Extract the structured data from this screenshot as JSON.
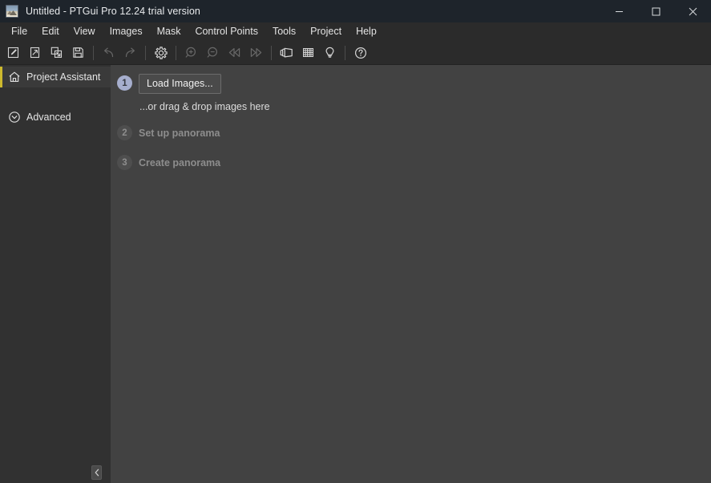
{
  "window": {
    "title": "Untitled - PTGui Pro 12.24 trial version",
    "app_icon": "panorama-image-icon",
    "controls": {
      "minimize": "minimize-icon",
      "maximize": "maximize-icon",
      "close": "close-icon"
    },
    "titlebar_color": "#1e242b"
  },
  "menubar": {
    "items": [
      {
        "label": "File"
      },
      {
        "label": "Edit"
      },
      {
        "label": "View"
      },
      {
        "label": "Images"
      },
      {
        "label": "Mask"
      },
      {
        "label": "Control Points"
      },
      {
        "label": "Tools"
      },
      {
        "label": "Project"
      },
      {
        "label": "Help"
      }
    ]
  },
  "toolbar": {
    "groups": [
      {
        "buttons": [
          {
            "icon": "new-project-icon",
            "enabled": true
          },
          {
            "icon": "open-project-icon",
            "enabled": true
          },
          {
            "icon": "save-as-icon",
            "enabled": true
          },
          {
            "icon": "save-icon",
            "enabled": true
          }
        ]
      },
      {
        "buttons": [
          {
            "icon": "undo-icon",
            "enabled": false
          },
          {
            "icon": "redo-icon",
            "enabled": false
          }
        ]
      },
      {
        "buttons": [
          {
            "icon": "gear-icon",
            "enabled": true
          }
        ]
      },
      {
        "buttons": [
          {
            "icon": "zoom-in-icon",
            "enabled": false
          },
          {
            "icon": "zoom-out-icon",
            "enabled": false
          },
          {
            "icon": "previous-image-icon",
            "enabled": false
          },
          {
            "icon": "next-image-icon",
            "enabled": false
          }
        ]
      },
      {
        "buttons": [
          {
            "icon": "panorama-editor-icon",
            "enabled": true
          },
          {
            "icon": "grid-icon",
            "enabled": true
          },
          {
            "icon": "lightbulb-icon",
            "enabled": true
          }
        ]
      },
      {
        "buttons": [
          {
            "icon": "help-icon",
            "enabled": true
          }
        ]
      }
    ]
  },
  "sidebar": {
    "accent_color": "#cdb92e",
    "items": [
      {
        "label": "Project Assistant",
        "icon": "home-icon",
        "active": true
      },
      {
        "label": "Advanced",
        "icon": "chevron-down-circle-icon",
        "active": false
      }
    ],
    "collapse_button": "chevron-left-icon"
  },
  "main": {
    "steps": [
      {
        "number": "1",
        "state": "active",
        "button_label": "Load Images...",
        "hint": "...or drag & drop images here"
      },
      {
        "number": "2",
        "state": "inactive",
        "label": "Set up panorama"
      },
      {
        "number": "3",
        "state": "inactive",
        "label": "Create panorama"
      }
    ]
  }
}
